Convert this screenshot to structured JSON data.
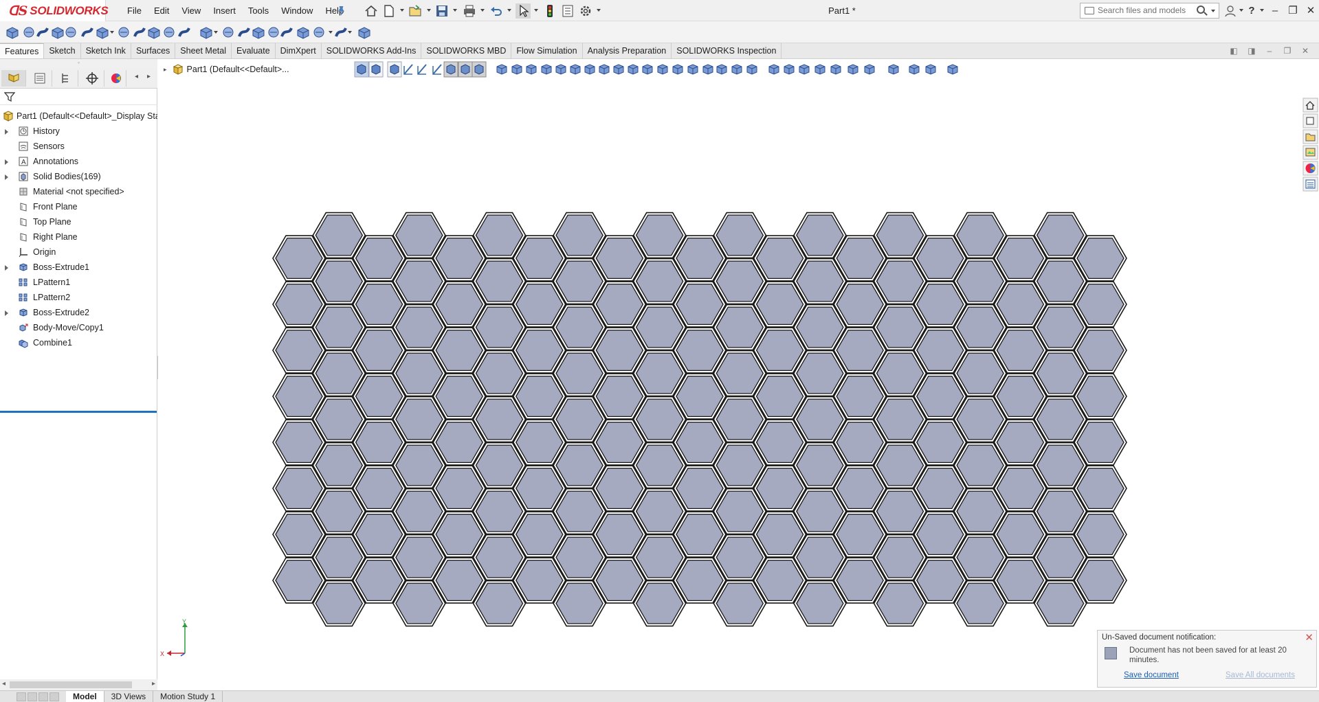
{
  "app": {
    "brand": "SOLIDWORKS",
    "document_title": "Part1 *"
  },
  "menu": [
    "File",
    "Edit",
    "View",
    "Insert",
    "Tools",
    "Window",
    "Help"
  ],
  "search": {
    "placeholder": "Search files and models"
  },
  "command_tabs": [
    "Features",
    "Sketch",
    "Sketch Ink",
    "Surfaces",
    "Sheet Metal",
    "Evaluate",
    "DimXpert",
    "SOLIDWORKS Add-Ins",
    "SOLIDWORKS MBD",
    "Flow Simulation",
    "Analysis Preparation",
    "SOLIDWORKS Inspection"
  ],
  "active_tab": "Features",
  "feature_tree": {
    "root": "Part1  (Default<<Default>_Display Stat",
    "items": [
      {
        "label": "History",
        "expandable": true,
        "icon": "history-icon"
      },
      {
        "label": "Sensors",
        "expandable": false,
        "icon": "sensor-icon"
      },
      {
        "label": "Annotations",
        "expandable": true,
        "icon": "annotation-icon"
      },
      {
        "label": "Solid Bodies(169)",
        "expandable": true,
        "icon": "solid-bodies-icon"
      },
      {
        "label": "Material <not specified>",
        "expandable": false,
        "icon": "material-icon"
      },
      {
        "label": "Front Plane",
        "expandable": false,
        "icon": "plane-icon"
      },
      {
        "label": "Top Plane",
        "expandable": false,
        "icon": "plane-icon"
      },
      {
        "label": "Right Plane",
        "expandable": false,
        "icon": "plane-icon"
      },
      {
        "label": "Origin",
        "expandable": false,
        "icon": "origin-icon"
      },
      {
        "label": "Boss-Extrude1",
        "expandable": true,
        "icon": "extrude-icon"
      },
      {
        "label": "LPattern1",
        "expandable": false,
        "icon": "linear-pattern-icon"
      },
      {
        "label": "LPattern2",
        "expandable": false,
        "icon": "linear-pattern-icon"
      },
      {
        "label": "Boss-Extrude2",
        "expandable": true,
        "icon": "extrude-icon"
      },
      {
        "label": "Body-Move/Copy1",
        "expandable": false,
        "icon": "move-copy-icon"
      },
      {
        "label": "Combine1",
        "expandable": false,
        "icon": "combine-icon"
      }
    ]
  },
  "breadcrumb": "Part1  (Default<<Default>...",
  "notification": {
    "title": "Un-Saved document notification:",
    "message": "Document has not been saved for at least 20 minutes.",
    "link_save": "Save document",
    "link_save_all": "Save All documents"
  },
  "bottom_tabs": [
    "Model",
    "3D Views",
    "Motion Study 1"
  ],
  "active_bottom_tab": "Model",
  "triad": {
    "x": "X",
    "y": "Y"
  },
  "colors": {
    "brand_red": "#d4282e",
    "hex_fill": "#a5aac0",
    "hex_edge": "#1a1a1a",
    "selection_blue": "#1e73be"
  },
  "hex_grid": {
    "columns": 21,
    "even_column_rows": 8,
    "odd_column_rows": 9
  }
}
